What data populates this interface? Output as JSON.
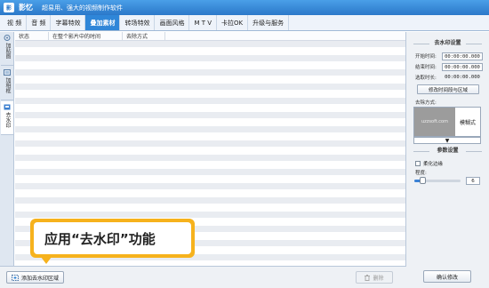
{
  "titlebar": {
    "app_logo": "影",
    "app_name": "影忆",
    "slogan": "超易用、强大的视频制作软件"
  },
  "menu": {
    "tabs": [
      {
        "label": "视 频",
        "active": false
      },
      {
        "label": "音 频",
        "active": false
      },
      {
        "label": "字幕特效",
        "active": false
      },
      {
        "label": "叠加素材",
        "active": true
      },
      {
        "label": "转场特效",
        "active": false
      },
      {
        "label": "画面风格",
        "active": false
      },
      {
        "label": "M T V",
        "active": false
      },
      {
        "label": "卡拉OK",
        "active": false
      },
      {
        "label": "升级与服务",
        "active": false
      }
    ]
  },
  "sidebar": {
    "tabs": [
      {
        "label": "加贴图",
        "icon": "sticker-icon",
        "active": false
      },
      {
        "label": "加相框",
        "icon": "frame-icon",
        "active": false
      },
      {
        "label": "去水印",
        "icon": "watermark-icon",
        "active": true
      }
    ]
  },
  "table": {
    "columns": [
      "状态",
      "在整个影片中的时间",
      "去除方式"
    ],
    "rows": []
  },
  "bottom": {
    "add_button": "添加去水印区域",
    "delete_button": "删除"
  },
  "tooltip": {
    "text": "应用“去水印”功能"
  },
  "panel": {
    "section1_title": "去水印设置",
    "start_label": "开始时间:",
    "start_value": "00:00:00.000",
    "end_label": "结束时间:",
    "end_value": "00:00:00.000",
    "duration_label": "选取时长:",
    "duration_value": "00:00:00.000",
    "modify_time_button": "修改时间段与区域",
    "method_label": "去除方式:",
    "method_thumb_text": "uzzsoft.com",
    "method_name": "模糊式",
    "method_dropdown": "▼",
    "section2_title": "参数设置",
    "soften_label": "柔化边缘",
    "degree_label": "程度:",
    "degree_value": "6",
    "degree_fraction": 0.18,
    "confirm_button": "确认修改"
  }
}
